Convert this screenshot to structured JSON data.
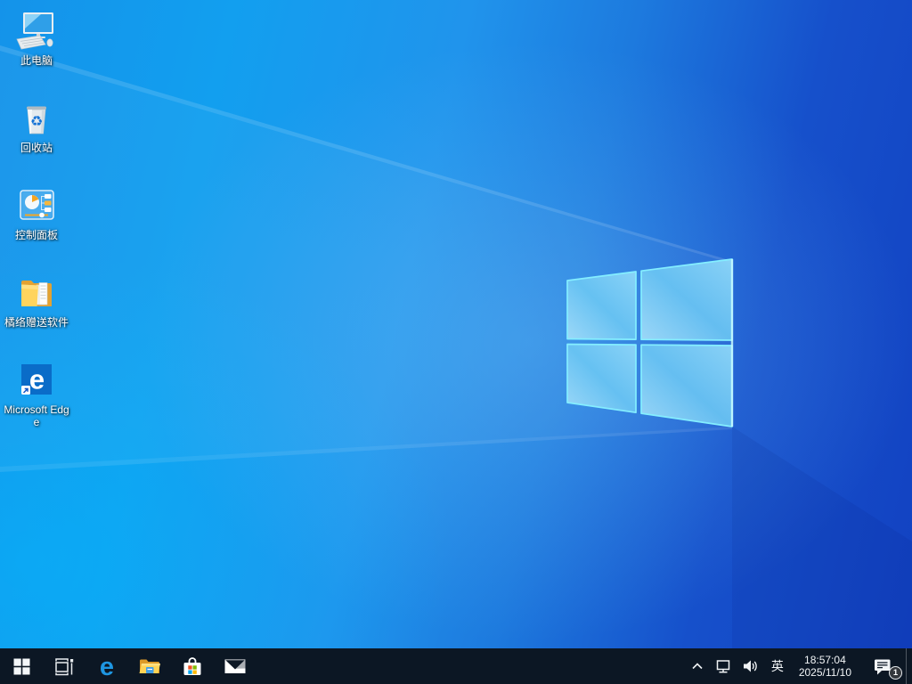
{
  "desktop": {
    "icons": [
      {
        "id": "this-pc",
        "icon": "computer-icon",
        "label": "此电脑"
      },
      {
        "id": "recycle-bin",
        "icon": "recycle-bin-icon",
        "label": "回收站"
      },
      {
        "id": "control-panel",
        "icon": "control-panel-icon",
        "label": "控制面板"
      },
      {
        "id": "gift-software",
        "icon": "folder-icon",
        "label": "橘络赠送软件"
      },
      {
        "id": "microsoft-edge",
        "icon": "edge-icon",
        "label": "Microsoft Edge"
      }
    ]
  },
  "taskbar": {
    "buttons": [
      {
        "id": "start",
        "icon": "windows-logo-icon"
      },
      {
        "id": "task-view",
        "icon": "task-view-icon"
      },
      {
        "id": "edge",
        "icon": "edge-e-icon"
      },
      {
        "id": "file-explorer",
        "icon": "folder-icon"
      },
      {
        "id": "microsoft-store",
        "icon": "store-bag-icon"
      },
      {
        "id": "mail",
        "icon": "envelope-icon"
      }
    ],
    "tray": {
      "language": "英",
      "time": "18:57:04",
      "date": "2025/11/10",
      "notification_count": "1"
    }
  },
  "colors": {
    "taskbar_bg": "#0c1724",
    "wallpaper_bright": "#00a6f4",
    "wallpaper_dark": "#1241c1",
    "logo_edge": "#84eeff",
    "edge_tile_blue": "#0a6cc8",
    "folder_yellow": "#ffd45e",
    "ms_red": "#f25022",
    "ms_green": "#7fba00",
    "ms_blue": "#00a4ef",
    "ms_yellow": "#ffb900"
  }
}
